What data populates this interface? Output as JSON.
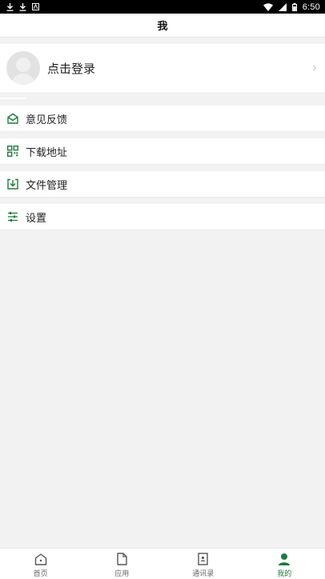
{
  "status_bar": {
    "time": "6:50"
  },
  "header": {
    "title": "我"
  },
  "profile": {
    "login_label": "点击登录"
  },
  "menu": [
    {
      "label": "意见反馈",
      "icon": "feedback-mail-icon"
    },
    {
      "label": "下载地址",
      "icon": "qrcode-icon"
    },
    {
      "label": "文件管理",
      "icon": "download-box-icon"
    },
    {
      "label": "设置",
      "icon": "settings-sliders-icon"
    }
  ],
  "tabs": [
    {
      "label": "首页",
      "icon": "home-icon",
      "active": false
    },
    {
      "label": "应用",
      "icon": "document-icon",
      "active": false
    },
    {
      "label": "通讯录",
      "icon": "contacts-book-icon",
      "active": false
    },
    {
      "label": "我的",
      "icon": "user-icon",
      "active": true
    }
  ],
  "colors": {
    "accent": "#1f7a3f",
    "background": "#f2f2f2"
  }
}
